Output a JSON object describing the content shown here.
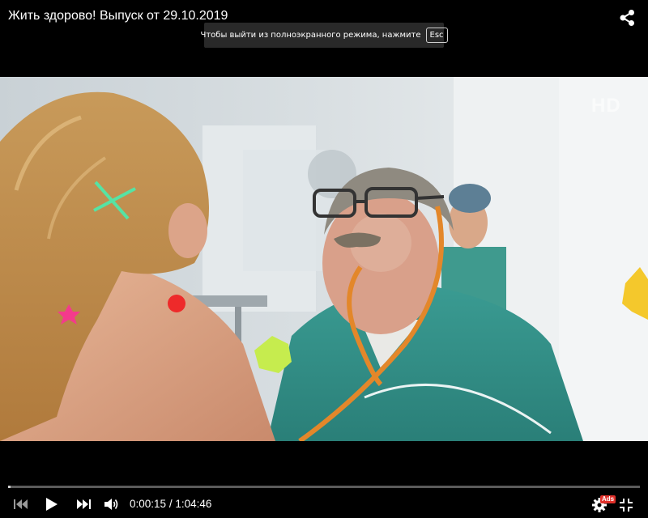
{
  "player": {
    "title": "Жить здорово! Выпуск от 29.10.2019",
    "fullscreen_notice": {
      "text": "Чтобы выйти из полноэкранного режима, нажмите",
      "key": "Esc"
    },
    "channel_logo": "HD",
    "progress_fraction": 0.0024,
    "time": {
      "current": "0:00:15",
      "separator": "/",
      "total": "1:04:46",
      "display": "0:00:15 / 1:04:46"
    },
    "ads_badge": "Ads",
    "colors": {
      "background": "#000000",
      "progress_played": "#cfcfcf",
      "progress_track": "#5a5a5a",
      "ads_badge": "#e0302a"
    },
    "icons": {
      "share": "share-icon",
      "previous": "skip-previous-icon",
      "play": "play-icon",
      "next": "skip-next-icon",
      "volume": "volume-icon",
      "settings": "gear-icon",
      "exit_fullscreen": "exit-fullscreen-icon"
    }
  }
}
